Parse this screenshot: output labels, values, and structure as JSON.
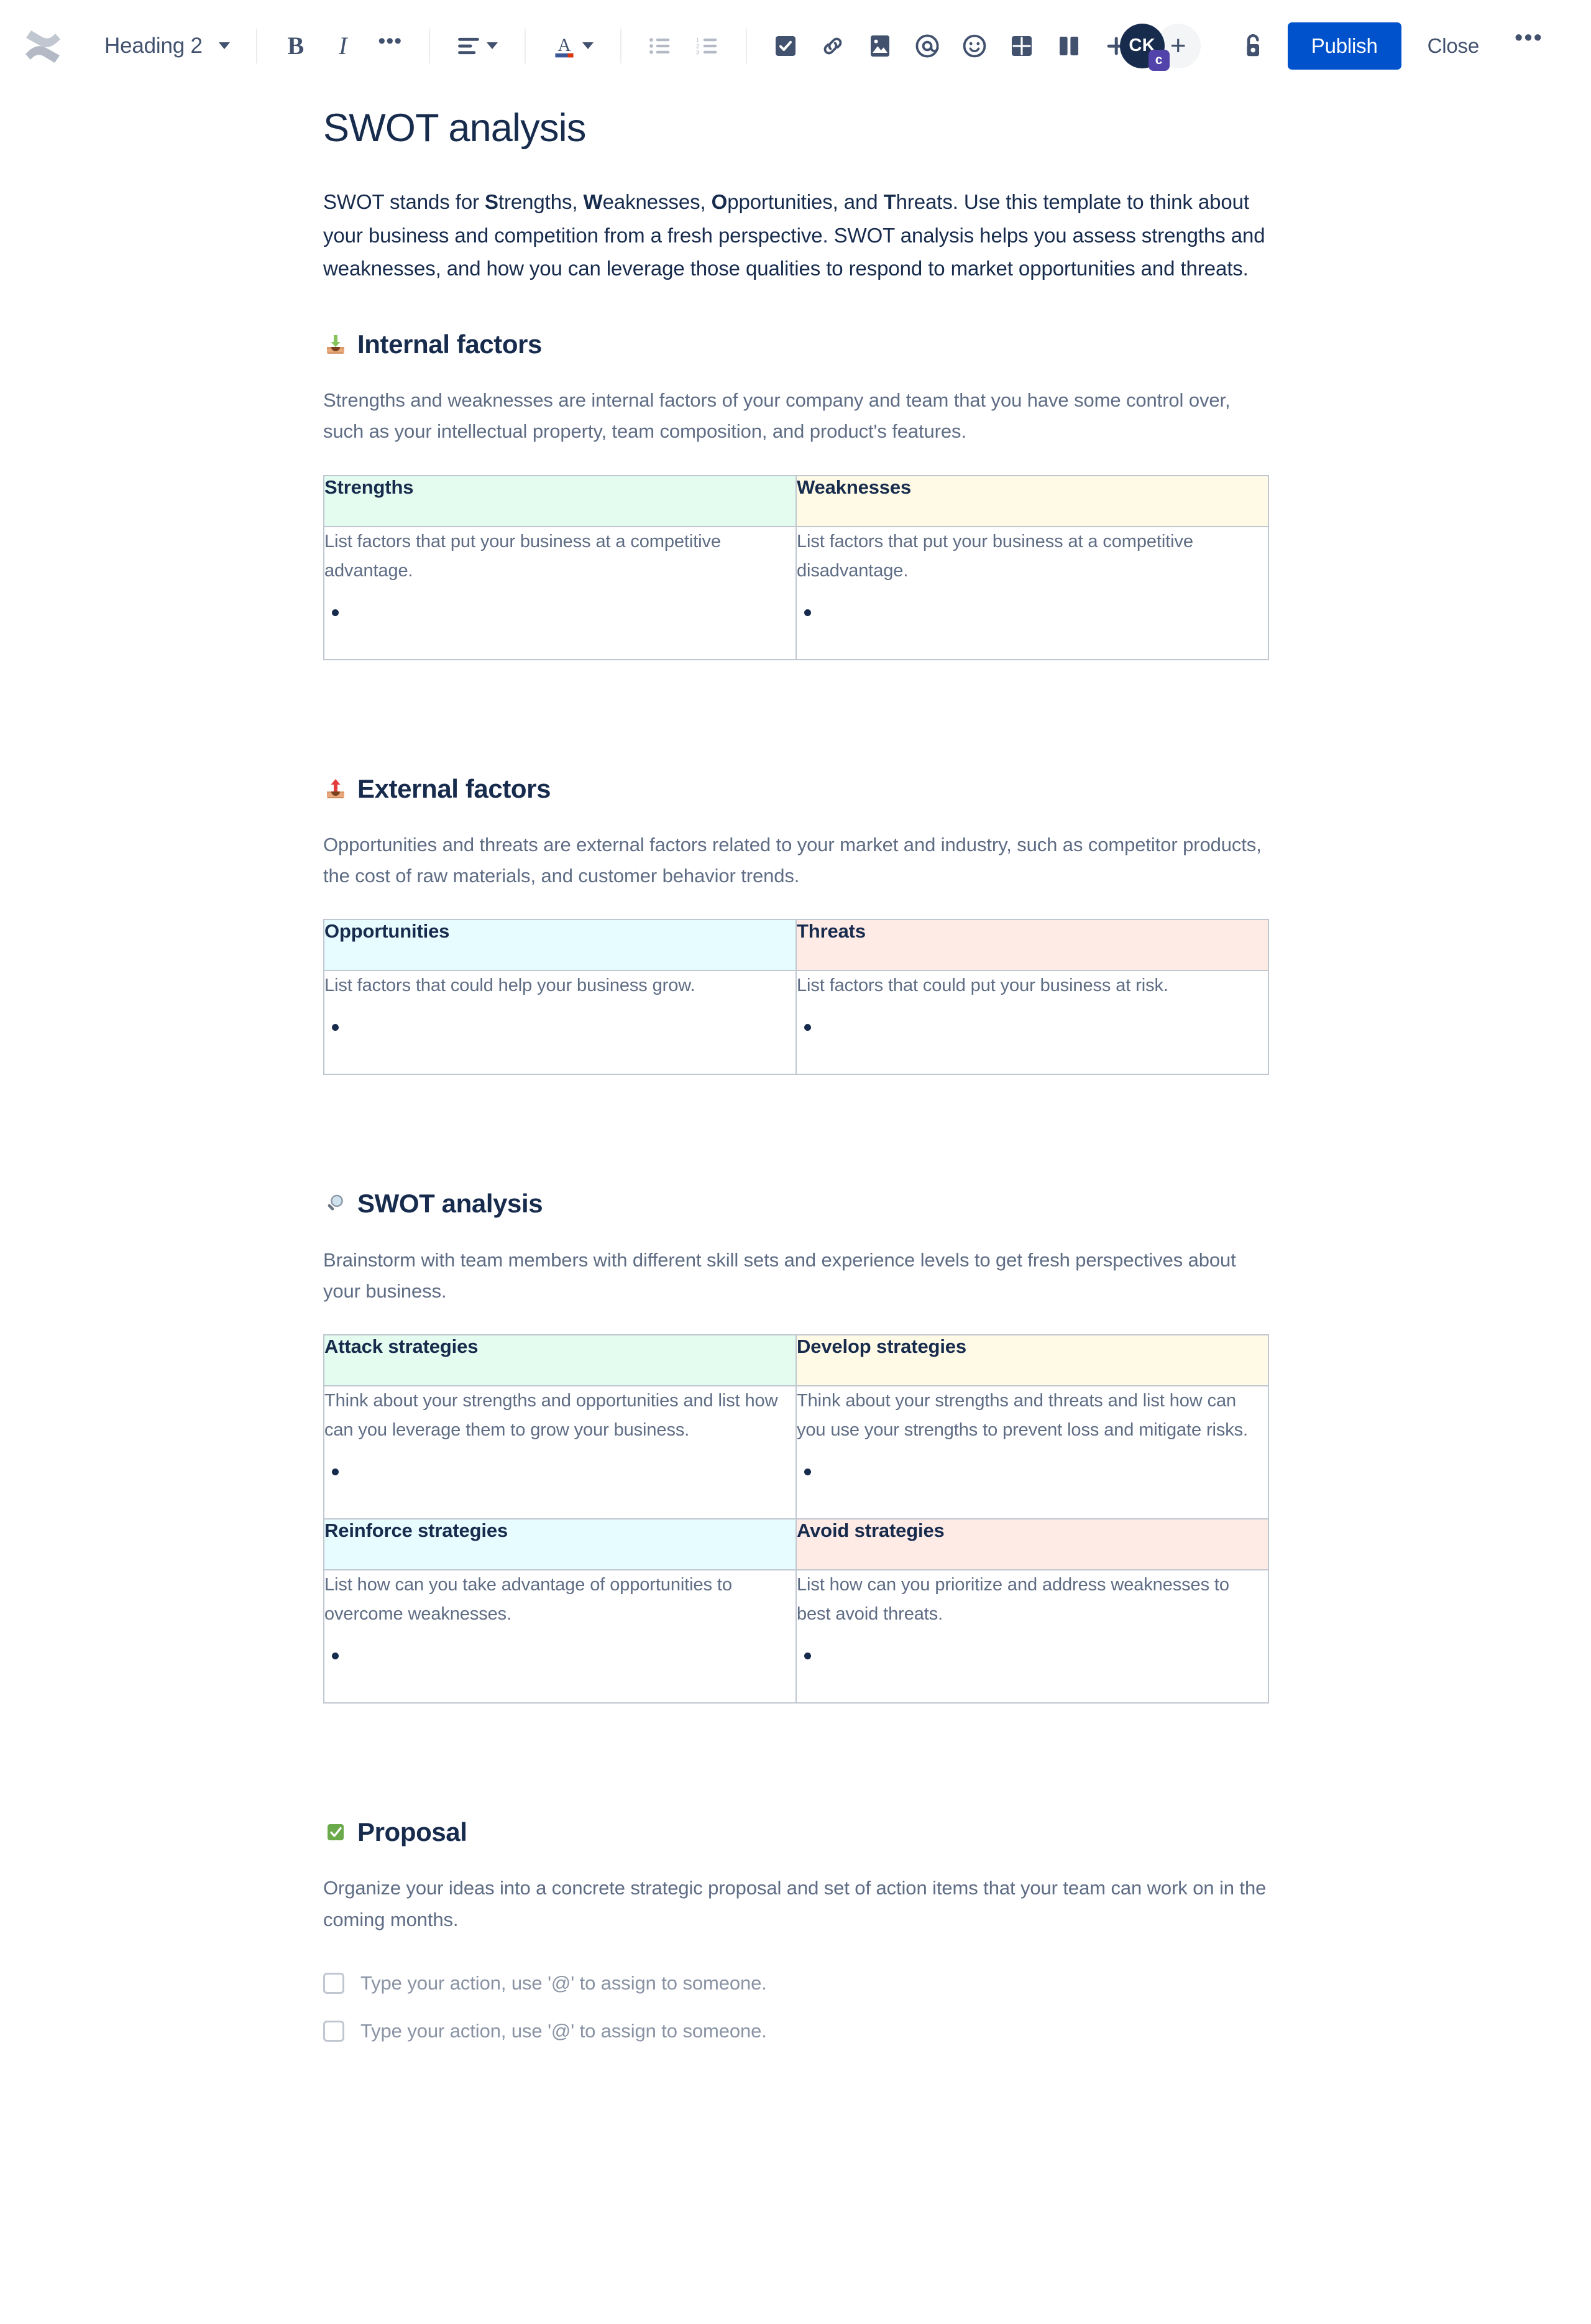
{
  "toolbar": {
    "logo_icon": "confluence-logo-icon",
    "style_select": {
      "label": "Heading 2",
      "icon": "chevron-down-icon"
    },
    "bold_label": "B",
    "italic_label": "I",
    "more_formatting_label": "•••",
    "groups": [
      {
        "name": "align",
        "icon": "text-align-left-icon",
        "has_chevron": true
      },
      {
        "name": "text-color",
        "icon": "text-color-a-icon",
        "has_chevron": true
      }
    ],
    "list_buttons": [
      {
        "name": "bullet-list",
        "icon": "bullet-list-icon"
      },
      {
        "name": "numbered-list",
        "icon": "numbered-list-icon"
      }
    ],
    "insert_buttons": [
      {
        "name": "task-list",
        "icon": "checkbox-task-icon"
      },
      {
        "name": "link",
        "icon": "link-chain-icon"
      },
      {
        "name": "image",
        "icon": "image-picture-icon"
      },
      {
        "name": "mention",
        "icon": "mention-at-icon"
      },
      {
        "name": "emoji",
        "icon": "emoji-smiley-icon"
      },
      {
        "name": "table",
        "icon": "table-grid-icon"
      },
      {
        "name": "layout",
        "icon": "page-layout-columns-icon"
      },
      {
        "name": "insert-more",
        "icon": "plus-icon",
        "has_chevron": true
      }
    ],
    "avatar": {
      "initials": "CK",
      "badge": "c",
      "badge_color": "#5243aa",
      "bg_color": "#172b4d"
    },
    "add_person_label": "+",
    "restrictions_icon": "unlock-padlock-icon",
    "publish_label": "Publish",
    "publish_color": "#0052cc",
    "close_label": "Close",
    "more_label": "•••"
  },
  "document": {
    "title": "SWOT analysis",
    "intro": {
      "prefix": "SWOT stands for ",
      "b1": "S",
      "t1": "trengths, ",
      "b2": "W",
      "t2": "eaknesses, ",
      "b3": "O",
      "t3": "pportunities, and ",
      "b4": "T",
      "t4": "hreats. Use this template to think about your business and competition from a fresh perspective. SWOT analysis helps you assess strengths and weaknesses, and how you can leverage those qualities to respond to market opportunities and threats."
    },
    "sections": [
      {
        "emoji_name": "inbox-tray-emoji",
        "heading": "Internal factors",
        "description": "Strengths and weaknesses are internal factors of your company and team that you have some control over, such as your intellectual property, team composition, and product's features.",
        "table": {
          "headers": [
            {
              "label": "Strengths",
              "bg": "#e3fcef"
            },
            {
              "label": "Weaknesses",
              "bg": "#fffae6"
            }
          ],
          "cells": [
            "List factors that put your business at a competitive advantage.",
            "List factors that put your business at a competitive disadvantage."
          ]
        }
      },
      {
        "emoji_name": "outbox-tray-emoji",
        "heading": "External factors",
        "description": "Opportunities and threats are external factors related to your market and industry, such as competitor products, the cost of raw materials, and customer behavior trends.",
        "table": {
          "headers": [
            {
              "label": "Opportunities",
              "bg": "#e6fcff"
            },
            {
              "label": "Threats",
              "bg": "#ffebe6"
            }
          ],
          "cells": [
            "List factors that could help your business grow.",
            "List factors that could put your business at risk."
          ]
        }
      },
      {
        "emoji_name": "magnifying-glass-emoji",
        "heading": "SWOT analysis",
        "description": "Brainstorm with team members with different skill sets and experience levels to get fresh perspectives about your business.",
        "table": {
          "headers": [
            {
              "label": "Attack strategies",
              "bg": "#e3fcef"
            },
            {
              "label": "Develop strategies",
              "bg": "#fffae6"
            }
          ],
          "cells": [
            "Think about your strengths and opportunities and list how can you leverage them to grow your business.",
            "Think about your strengths and threats and list how can you use your strengths to prevent loss and mitigate risks."
          ],
          "headers2": [
            {
              "label": "Reinforce strategies",
              "bg": "#e6fcff"
            },
            {
              "label": "Avoid strategies",
              "bg": "#ffebe6"
            }
          ],
          "cells2": [
            "List how can you take advantage of opportunities to overcome weaknesses.",
            "List how can you prioritize and address weaknesses to best avoid threats."
          ]
        }
      }
    ],
    "proposal": {
      "emoji_name": "white-check-mark-emoji",
      "heading": "Proposal",
      "description": "Organize your ideas into a concrete strategic proposal and set of action items that your team can work on in the coming months.",
      "actions": [
        "Type your action, use '@' to assign to someone.",
        "Type your action, use '@' to assign to someone."
      ]
    }
  }
}
